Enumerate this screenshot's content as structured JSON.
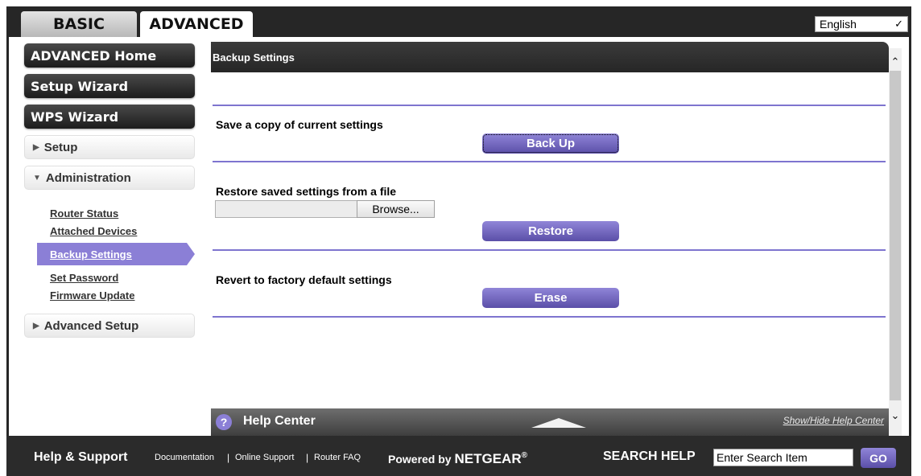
{
  "tabs": {
    "basic": "BASIC",
    "advanced": "ADVANCED"
  },
  "language": {
    "selected": "English"
  },
  "sidebar": {
    "advanced_home": "ADVANCED Home",
    "setup_wizard": "Setup Wizard",
    "wps_wizard": "WPS Wizard",
    "setup": "Setup",
    "administration": "Administration",
    "admin_items": [
      "Router Status",
      "Attached Devices",
      "Backup Settings",
      "Set Password",
      "Firmware Update"
    ],
    "advanced_setup": "Advanced Setup"
  },
  "panel": {
    "title": "Backup Settings",
    "backup_label": "Save a copy of current settings",
    "backup_button": "Back Up",
    "restore_label": "Restore saved settings from a file",
    "browse_button": "Browse...",
    "restore_button": "Restore",
    "erase_label": "Revert to factory default settings",
    "erase_button": "Erase"
  },
  "help_center": {
    "title": "Help Center",
    "toggle_link": "Show/Hide Help Center"
  },
  "footer": {
    "title": "Help & Support",
    "links": [
      "Documentation",
      "Online Support",
      "Router FAQ"
    ],
    "powered_prefix": "Powered by",
    "brand": "NETGEAR",
    "search_label": "SEARCH HELP",
    "search_value": "Enter Search Item",
    "go_button": "GO"
  },
  "colors": {
    "accent": "#8b7fd6",
    "dark": "#262626"
  }
}
